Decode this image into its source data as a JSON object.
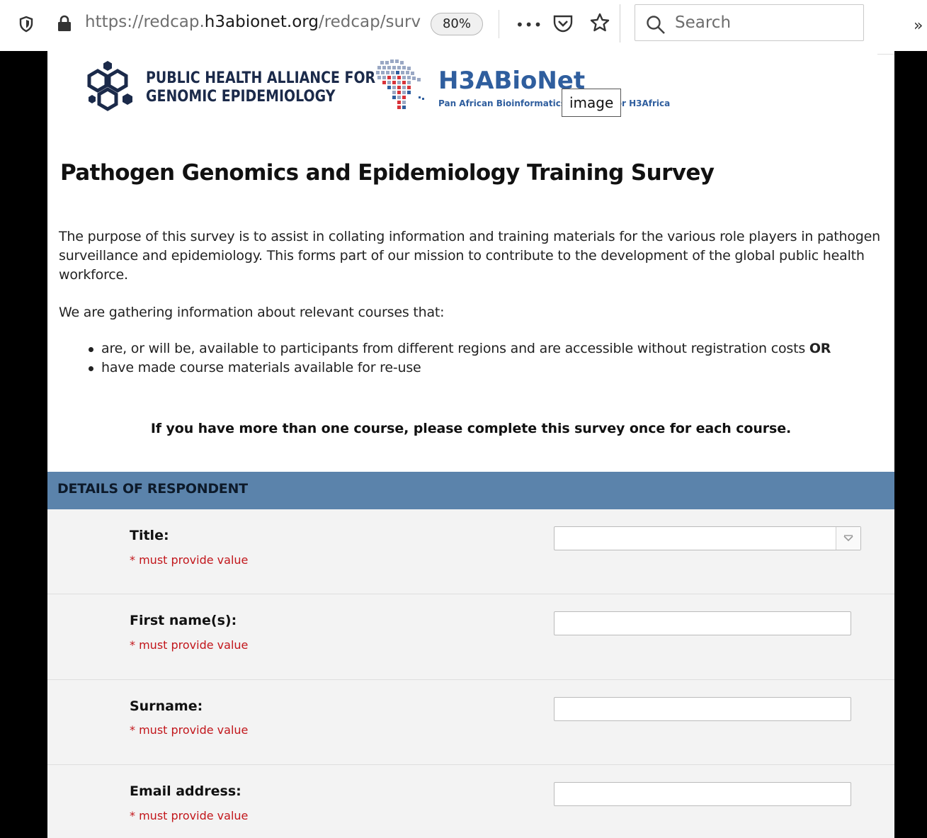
{
  "browser": {
    "url_prefix": "https://redcap.",
    "url_host": "h3abionet.org",
    "url_path": "/redcap/surv",
    "zoom": "80%",
    "more_glyph": "•••",
    "overflow_glyph": "»",
    "search_placeholder": "Search"
  },
  "logos": {
    "phage_line1": "PUBLIC HEALTH ALLIANCE FOR",
    "phage_line2": "GENOMIC EPIDEMIOLOGY",
    "h3a_title": "H3ABioNet",
    "h3a_subtitle": "Pan African Bioinformatics Network for H3Africa",
    "tooltip": "image"
  },
  "survey": {
    "title": "Pathogen Genomics and Epidemiology Training Survey",
    "intro": "The purpose of this survey is to assist in collating information and training materials for the various role players in pathogen surveillance and epidemiology. This forms part of our mission to contribute to the development of the global public health workforce.",
    "gathering": "We are gathering information about relevant courses that:",
    "bullet1": "are, or will be, available to participants from different regions and are accessible without registration costs ",
    "bullet1_bold": "OR",
    "bullet2": "have made course materials available for re-use",
    "note": "If you have more than one course, please complete this survey once for each course."
  },
  "section": {
    "title": "DETAILS OF RESPONDENT"
  },
  "fields": {
    "title": {
      "label": "Title:",
      "required": "* must provide value",
      "value": ""
    },
    "first_name": {
      "label": "First name(s):",
      "required": "* must provide value",
      "value": ""
    },
    "surname": {
      "label": "Surname:",
      "required": "* must provide value",
      "value": ""
    },
    "email": {
      "label": "Email address:",
      "required": "* must provide value",
      "value": ""
    }
  }
}
